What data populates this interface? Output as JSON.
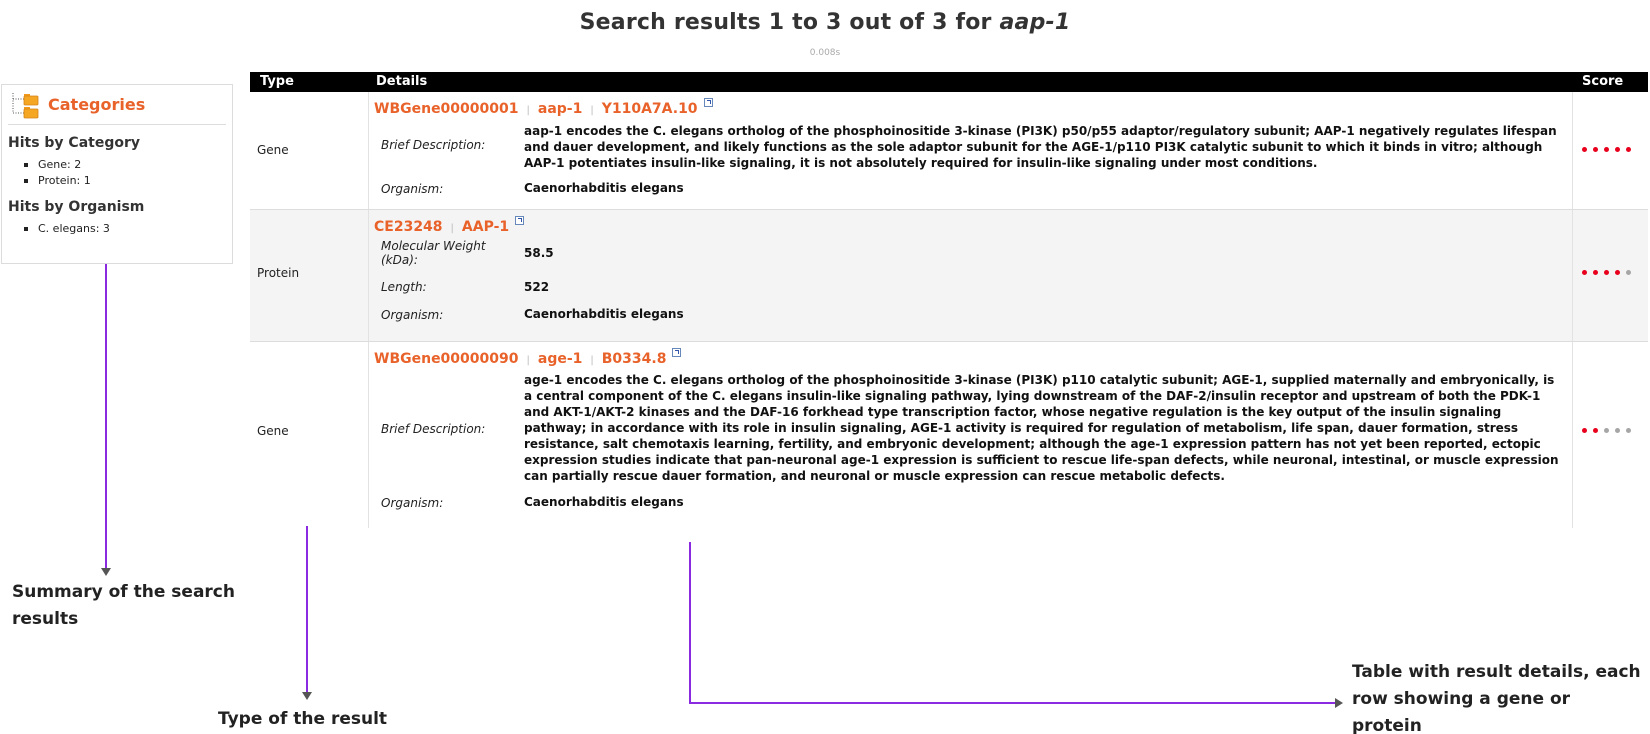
{
  "header": {
    "title_prefix": "Search results 1 to 3 out of 3 for",
    "query": "aap-1",
    "timing": "0.008s"
  },
  "sidebar": {
    "title": "Categories",
    "by_category_heading": "Hits by Category",
    "by_category": [
      "Gene: 2",
      "Protein: 1"
    ],
    "by_organism_heading": "Hits by Organism",
    "by_organism": [
      "C. elegans: 3"
    ]
  },
  "table": {
    "headers": {
      "type": "Type",
      "details": "Details",
      "score": "Score"
    },
    "rows": [
      {
        "type": "Gene",
        "links": [
          "WBGene00000001",
          "aap-1",
          "Y110A7A.10"
        ],
        "fields": [
          {
            "label": "Brief Description:",
            "value": "aap-1 encodes the C. elegans ortholog of the phosphoinositide 3-kinase (PI3K) p50/p55 adaptor/regulatory subunit; AAP-1 negatively regulates lifespan and dauer development, and likely functions as the sole adaptor subunit for the AGE-1/p110 PI3K catalytic subunit to which it binds in vitro; although AAP-1 potentiates insulin-like signaling, it is not absolutely required for insulin-like signaling under most conditions."
          },
          {
            "label": "Organism:",
            "value": "Caenorhabditis elegans"
          }
        ],
        "score": 5
      },
      {
        "type": "Protein",
        "links": [
          "CE23248",
          "AAP-1"
        ],
        "fields": [
          {
            "label": "Molecular Weight (kDa):",
            "value": "58.5"
          },
          {
            "label": "Length:",
            "value": "522"
          },
          {
            "label": "Organism:",
            "value": "Caenorhabditis elegans"
          }
        ],
        "score": 4
      },
      {
        "type": "Gene",
        "links": [
          "WBGene00000090",
          "age-1",
          "B0334.8"
        ],
        "fields": [
          {
            "label": "Brief Description:",
            "value": "age-1 encodes the C. elegans ortholog of the phosphoinositide 3-kinase (PI3K) p110 catalytic subunit; AGE-1, supplied maternally and embryonically, is a central component of the C. elegans insulin-like signaling pathway, lying downstream of the DAF-2/insulin receptor and upstream of both the PDK-1 and AKT-1/AKT-2 kinases and the DAF-16 forkhead type transcription factor, whose negative regulation is the key output of the insulin signaling pathway; in accordance with its role in insulin signaling, AGE-1 activity is required for regulation of metabolism, life span, dauer formation, stress resistance, salt chemotaxis learning, fertility, and embryonic development; although the age-1 expression pattern has not yet been reported, ectopic expression studies indicate that pan-neuronal age-1 expression is sufficient to rescue life-span defects, while neuronal, intestinal, or muscle expression can partially rescue dauer formation, and neuronal or muscle expression can rescue metabolic defects."
          },
          {
            "label": "Organism:",
            "value": "Caenorhabditis elegans"
          }
        ],
        "score": 2
      }
    ],
    "score_max": 5
  },
  "annotations": {
    "summary": "Summary of the search results",
    "type": "Type of the result",
    "table": "Table with result details, each row showing a gene or protein"
  },
  "colors": {
    "accent": "#e8622a",
    "score_on": "#e8001c",
    "score_off": "#a6a6a6",
    "annotation_line": "#8a2be2"
  }
}
